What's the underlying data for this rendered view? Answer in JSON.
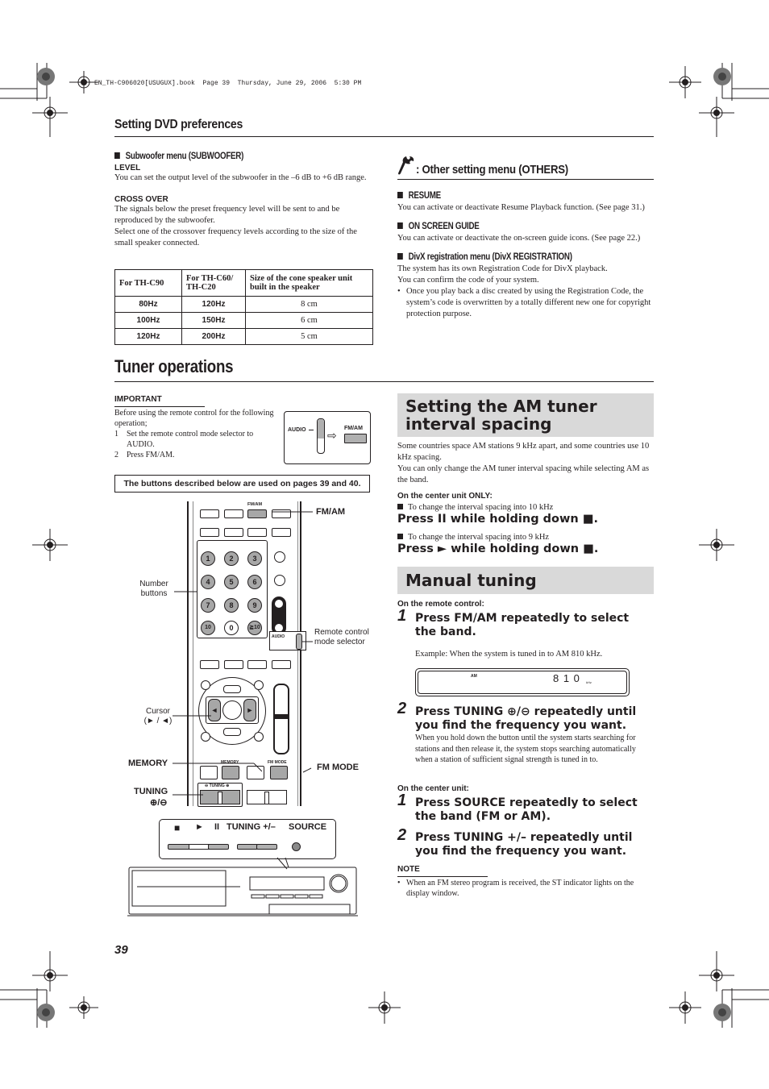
{
  "print_header": "EN_TH-C906020[USUGUX].book  Page 39  Thursday, June 29, 2006  5:30 PM",
  "section_title": "Setting DVD preferences",
  "subwoofer": {
    "heading": "Subwoofer menu (SUBWOOFER)",
    "level_label": "LEVEL",
    "level_text": "You can set the output level of the subwoofer in the –6 dB to +6 dB range.",
    "crossover_label": "CROSS OVER",
    "crossover_text_1": "The signals below the preset frequency level will be sent to and be reproduced by the subwoofer.",
    "crossover_text_2": "Select one of the crossover frequency levels according to the size of the small speaker connected.",
    "table": {
      "headers": [
        "For TH-C90",
        "For TH-C60/ TH-C20",
        "Size of the cone speaker unit built in the speaker"
      ],
      "rows": [
        [
          "80Hz",
          "120Hz",
          "8 cm"
        ],
        [
          "100Hz",
          "150Hz",
          "6 cm"
        ],
        [
          "120Hz",
          "200Hz",
          "5 cm"
        ]
      ]
    }
  },
  "others": {
    "heading": ": Other setting menu (OTHERS)",
    "icon": "wrench-icon",
    "resume_heading": "RESUME",
    "resume_text": "You can activate or deactivate Resume Playback function. (See page 31.)",
    "osg_heading": "ON SCREEN GUIDE",
    "osg_text": "You can activate or deactivate the on-screen guide icons. (See page 22.)",
    "divx_heading": "DivX registration menu (DivX REGISTRATION)",
    "divx_text_1": "The system has its own Registration Code for DivX playback.",
    "divx_text_2": "You can confirm the code of your system.",
    "divx_bullet": "Once you play back a disc created by using the Registration Code, the system’s code is overwritten by a totally different new one for copyright protection purpose."
  },
  "tuner": {
    "title": "Tuner operations",
    "important_label": "IMPORTANT",
    "important_intro": "Before using the remote control for the following operation;",
    "important_steps": [
      {
        "num": "1",
        "text": "Set the remote control mode selector to AUDIO."
      },
      {
        "num": "2",
        "text": "Press FM/AM."
      }
    ],
    "inset_audio_label": "AUDIO",
    "inset_fmam_label": "FM/AM",
    "pages_note": "The buttons described below are used on pages 39 and 40."
  },
  "remote": {
    "fmam_small": "FM/AM",
    "callouts": {
      "fmam": "FM/AM",
      "number_buttons": "Number buttons",
      "remote_mode_selector": "Remote control mode selector",
      "cursor": "Cursor (► / ◄)",
      "memory": "MEMORY",
      "fm_mode": "FM MODE",
      "tuning": "TUNING",
      "tuning_symbols": "⊕/⊖"
    },
    "number_keys": [
      "1",
      "2",
      "3",
      "4",
      "5",
      "6",
      "7",
      "8",
      "9",
      "10",
      "0",
      "≧10"
    ],
    "audio_label": "AUDIO",
    "memory_small": "MEMORY",
    "fm_mode_small": "FM MODE",
    "tuning_small": "⊖ TUNING ⊕",
    "cursor_left": "◄",
    "cursor_right": "►"
  },
  "center_unit": {
    "stop": "■",
    "play": "►",
    "pause": "II",
    "tuning": "TUNING +/–",
    "source": "SOURCE"
  },
  "am_spacing": {
    "title": "Setting the AM tuner interval spacing",
    "text_1": "Some countries space AM stations 9 kHz apart, and some countries use 10 kHz spacing.",
    "text_2": "You can only change the AM tuner interval spacing while selecting AM as the band.",
    "center_only_label": "On the center unit ONLY:",
    "to_10khz": "To change the interval spacing into 10 kHz",
    "press_10khz": "Press II while holding down ■.",
    "to_9khz": "To change the interval spacing into 9 kHz",
    "press_9khz": "Press ► while holding down ■."
  },
  "manual_tuning": {
    "title": "Manual tuning",
    "remote_label": "On the remote control:",
    "remote_steps": [
      {
        "num": "1",
        "text": "Press FM/AM repeatedly to select the band."
      },
      {
        "num": "2",
        "text": "Press TUNING ⊕/⊖ repeatedly until you find the frequency you want."
      }
    ],
    "example": "Example: When the system is tuned in to AM 810 kHz.",
    "display": {
      "band": "AM",
      "freq": "8 1 0",
      "unit": "kHz"
    },
    "step2_detail": "When you hold down the button until the system starts searching for stations and then release it, the system stops searching automatically when a station of sufficient signal strength is tuned in to.",
    "center_label": "On the center unit:",
    "center_steps": [
      {
        "num": "1",
        "text": "Press SOURCE repeatedly to select the band (FM or AM)."
      },
      {
        "num": "2",
        "text": "Press TUNING +/– repeatedly until you find the frequency you want."
      }
    ],
    "note_label": "NOTE",
    "note_text": "When an FM stereo program is received, the ST indicator lights on the display window."
  },
  "page_number": "39"
}
